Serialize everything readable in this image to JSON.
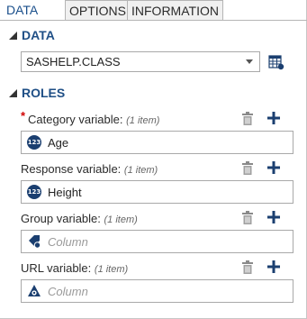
{
  "tabs": [
    {
      "label": "DATA",
      "active": true
    },
    {
      "label": "OPTIONS",
      "active": false
    },
    {
      "label": "INFORMATION",
      "active": false
    }
  ],
  "data_section": {
    "title": "DATA",
    "dataset": "SASHELP.CLASS",
    "table_icon": "table-settings-icon"
  },
  "roles_section": {
    "title": "ROLES",
    "roles": [
      {
        "label": "Category variable:",
        "count": "(1 item)",
        "required": "*",
        "value": "Age",
        "value_type": "numeric",
        "type_icon_text": "123"
      },
      {
        "label": "Response variable:",
        "count": "(1 item)",
        "required": "",
        "value": "Height",
        "value_type": "numeric",
        "type_icon_text": "123"
      },
      {
        "label": "Group variable:",
        "count": "(1 item)",
        "required": "",
        "placeholder": "Column",
        "value_type": "category"
      },
      {
        "label": "URL variable:",
        "count": "(1 item)",
        "required": "",
        "placeholder": "Column",
        "value_type": "url"
      }
    ]
  },
  "colors": {
    "accent": "#1f4f86",
    "required": "#d10000",
    "icon_dark": "#1b3f70",
    "trash": "#8a8a8a"
  }
}
